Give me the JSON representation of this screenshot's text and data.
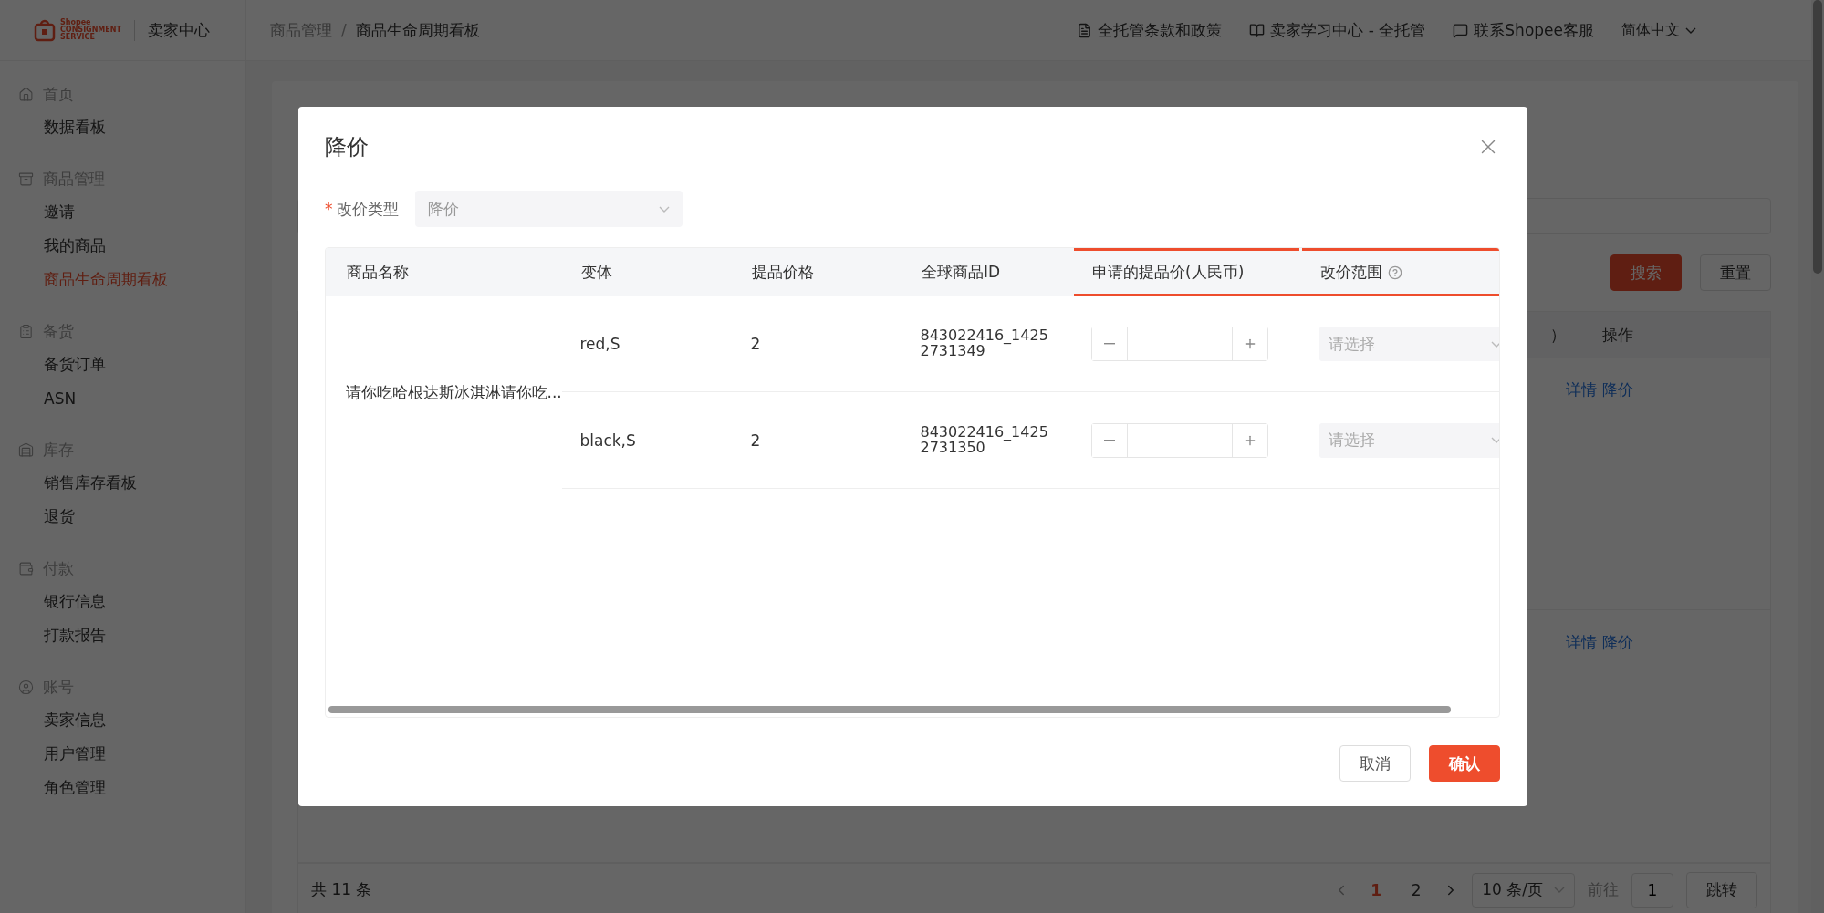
{
  "brand": {
    "logo_lines": [
      "Shopee",
      "CONSIGNMENT",
      "SERVICE"
    ],
    "title": "卖家中心"
  },
  "breadcrumb": [
    "商品管理",
    "商品生命周期看板"
  ],
  "breadcrumb_separator": "/",
  "header_links": [
    {
      "label": "全托管条款和政策",
      "kind": "doc"
    },
    {
      "label": "卖家学习中心 - 全托管",
      "kind": "book"
    },
    {
      "label": "联系Shopee客服",
      "kind": "chat"
    }
  ],
  "language": "简体中文",
  "sidebar": [
    {
      "label": "首页",
      "kind": "home",
      "children": [
        {
          "label": "数据看板",
          "selected": false
        }
      ]
    },
    {
      "label": "商品管理",
      "kind": "box",
      "children": [
        {
          "label": "邀请",
          "selected": false
        },
        {
          "label": "我的商品",
          "selected": false
        },
        {
          "label": "商品生命周期看板",
          "selected": true
        }
      ]
    },
    {
      "label": "备货",
      "kind": "clipboard",
      "children": [
        {
          "label": "备货订单",
          "selected": false
        },
        {
          "label": "ASN",
          "selected": false
        }
      ]
    },
    {
      "label": "库存",
      "kind": "warehouse",
      "children": [
        {
          "label": "销售库存看板",
          "selected": false
        },
        {
          "label": "退货",
          "selected": false
        }
      ]
    },
    {
      "label": "付款",
      "kind": "wallet",
      "children": [
        {
          "label": "银行信息",
          "selected": false
        },
        {
          "label": "打款报告",
          "selected": false
        }
      ]
    },
    {
      "label": "账号",
      "kind": "user",
      "children": [
        {
          "label": "卖家信息",
          "selected": false
        },
        {
          "label": "用户管理",
          "selected": false
        },
        {
          "label": "角色管理",
          "selected": false
        }
      ]
    }
  ],
  "page": {
    "search_button": "搜索",
    "reset_button": "重置",
    "columns": [
      "）",
      "操作"
    ],
    "rows": [
      {
        "actions": [
          "详情",
          "降价"
        ]
      },
      {
        "actions": [
          "详情",
          "降价"
        ]
      }
    ],
    "pagination": {
      "total": "共 11 条",
      "pages": [
        {
          "label": "1",
          "selected": true
        },
        {
          "label": "2",
          "selected": false
        }
      ],
      "page_size": "10 条/页",
      "goto_label": "前往",
      "goto_value": "1",
      "jump_button": "跳转"
    }
  },
  "dialog": {
    "title": "降价",
    "form": {
      "label": "改价类型",
      "required_mark": "*",
      "value": "降价"
    },
    "columns": [
      {
        "label": "商品名称",
        "highlighted": false,
        "help": false
      },
      {
        "label": "变体",
        "highlighted": false,
        "help": false
      },
      {
        "label": "提品价格",
        "highlighted": false,
        "help": false
      },
      {
        "label": "全球商品ID",
        "highlighted": false,
        "help": false
      },
      {
        "label": "申请的提品价(人民币)",
        "highlighted": true,
        "help": false
      },
      {
        "label": "改价范围",
        "highlighted": true,
        "help": true
      }
    ],
    "product_name": "请你吃哈根达斯冰淇淋请你吃...",
    "variants": [
      {
        "variant": "red,S",
        "price": "2",
        "global_id": "843022416_14252731349",
        "placeholder": "请选择"
      },
      {
        "variant": "black,S",
        "price": "2",
        "global_id": "843022416_14252731350",
        "placeholder": "请选择"
      }
    ],
    "buttons": [
      {
        "label": "取消",
        "kind": "secondary"
      },
      {
        "label": "确认",
        "kind": "primary"
      }
    ]
  }
}
